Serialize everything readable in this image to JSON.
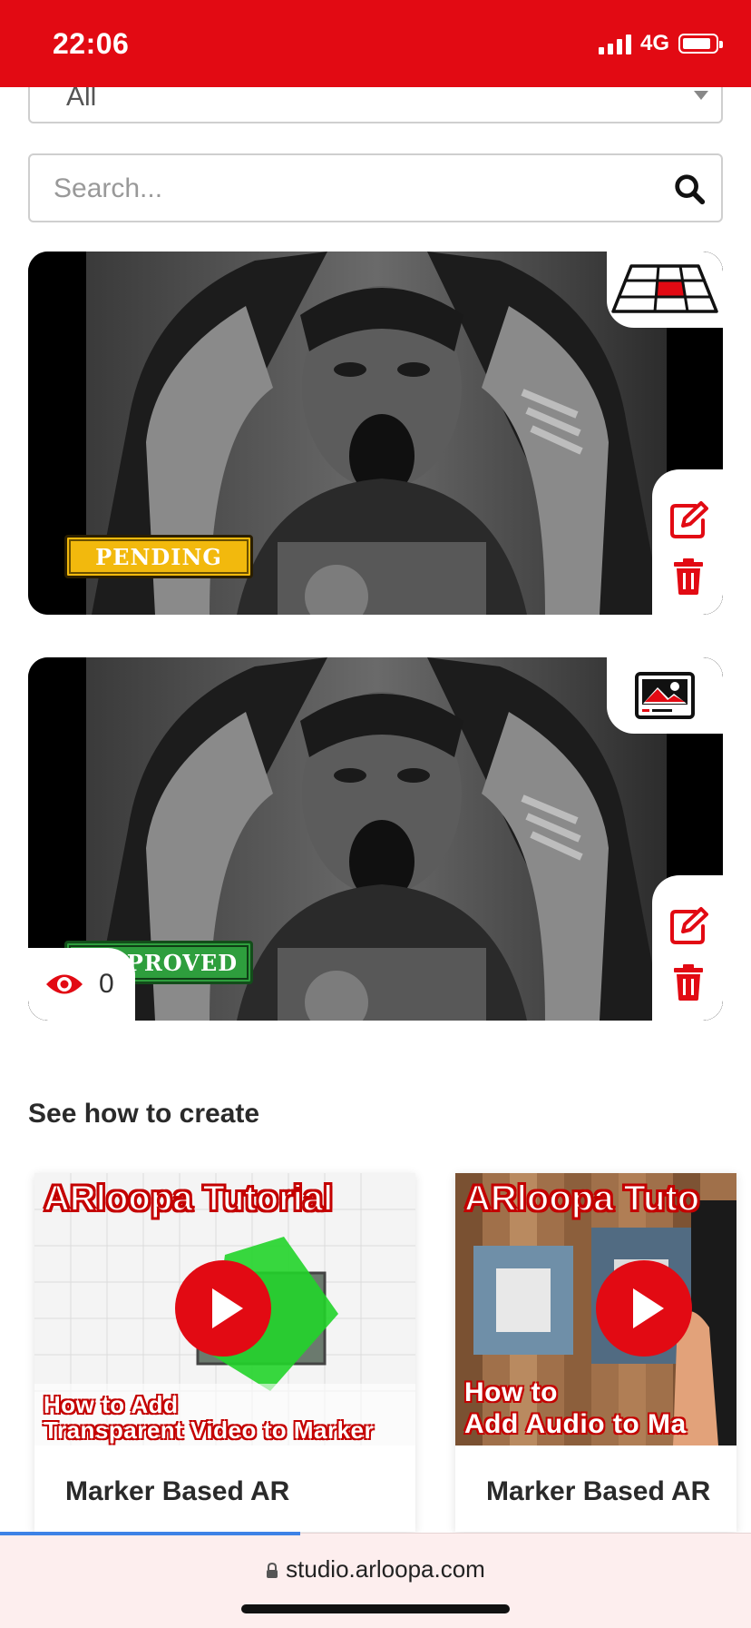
{
  "status_bar": {
    "time": "22:06",
    "network": "4G"
  },
  "filter": {
    "selected": "All"
  },
  "search": {
    "placeholder": "Search..."
  },
  "projects": [
    {
      "status": "PENDING",
      "type_icon": "floor-plane-icon"
    },
    {
      "status": "PROVED",
      "type_icon": "image-marker-icon",
      "views": "0"
    }
  ],
  "tutorials_section": {
    "title": "See how to create",
    "cards": [
      {
        "thumb_title": "ARloopa Tutorial",
        "thumb_line1": "How to Add",
        "thumb_line2": "Transparent Video to Marker",
        "label": "Marker Based AR"
      },
      {
        "thumb_title": "ARloopa Tuto",
        "thumb_line1": "How to",
        "thumb_line2": "Add Audio to Ma",
        "label": "Marker Based AR"
      }
    ]
  },
  "browser": {
    "url": "studio.arloopa.com",
    "load_progress": 0.4
  },
  "colors": {
    "brand_red": "#e20a13",
    "pending_yellow": "#f2b90d",
    "approved_green": "#2e9e3d",
    "progress_blue": "#3d82e6"
  }
}
